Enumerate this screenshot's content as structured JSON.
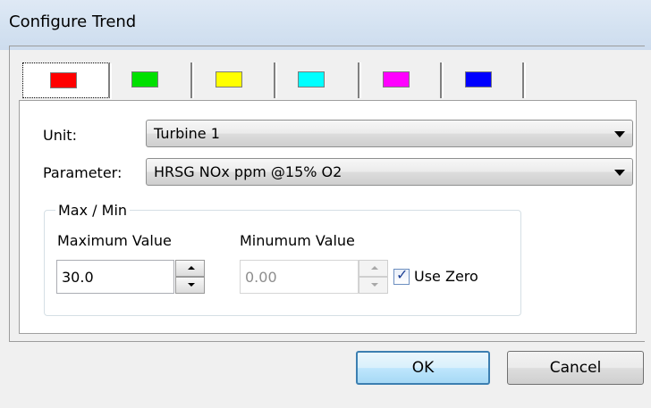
{
  "window": {
    "title": "Configure Trend"
  },
  "tabs": [
    {
      "color": "#ff0000",
      "icon": "red-swatch-icon",
      "active": true
    },
    {
      "color": "#00e000",
      "icon": "green-swatch-icon",
      "active": false
    },
    {
      "color": "#ffff00",
      "icon": "yellow-swatch-icon",
      "active": false
    },
    {
      "color": "#00ffff",
      "icon": "cyan-swatch-icon",
      "active": false
    },
    {
      "color": "#ff00ff",
      "icon": "magenta-swatch-icon",
      "active": false
    },
    {
      "color": "#0000ff",
      "icon": "blue-swatch-icon",
      "active": false
    }
  ],
  "form": {
    "unit_label": "Unit:",
    "unit_value": "Turbine 1",
    "parameter_label": "Parameter:",
    "parameter_value": "HRSG NOx ppm @15% O2",
    "group_title": "Max / Min",
    "max_label": "Maximum Value",
    "max_value": "30.0",
    "min_label": "Minumum Value",
    "min_value": "0.00",
    "use_zero_label": "Use Zero",
    "use_zero_checked": true
  },
  "buttons": {
    "ok": "OK",
    "cancel": "Cancel"
  }
}
